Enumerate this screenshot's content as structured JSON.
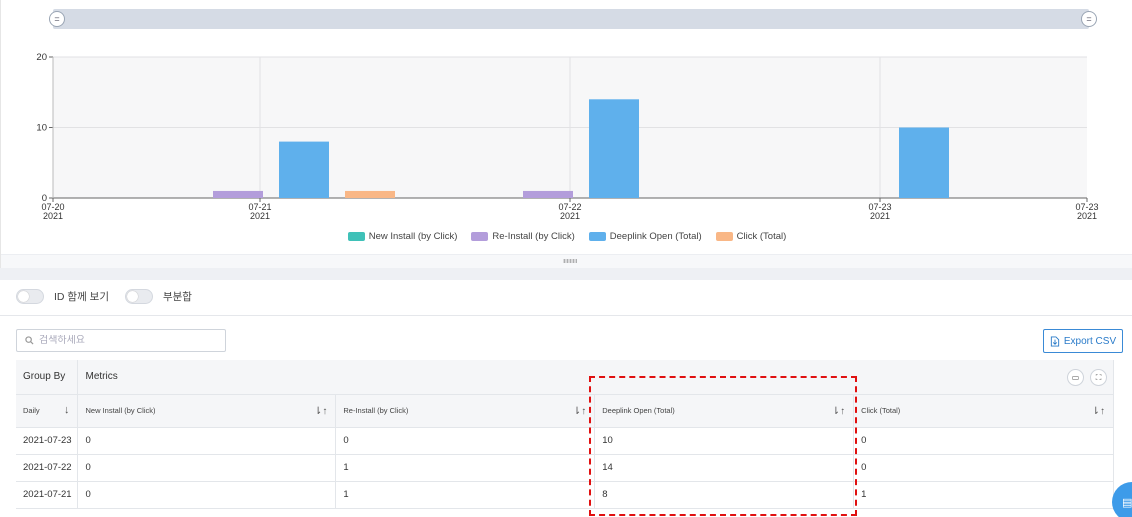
{
  "chart_data": {
    "type": "bar",
    "categories": [
      "07-20\n2021",
      "07-21\n2021",
      "07-22\n2021",
      "07-23\n2021",
      "07-23\n2021"
    ],
    "x_ticks": [
      {
        "line1": "07-20",
        "line2": "2021"
      },
      {
        "line1": "07-21",
        "line2": "2021"
      },
      {
        "line1": "07-22",
        "line2": "2021"
      },
      {
        "line1": "07-23",
        "line2": "2021"
      },
      {
        "line1": "07-23",
        "line2": "2021"
      }
    ],
    "y_ticks": [
      "0",
      "10",
      "20"
    ],
    "ylim": [
      0,
      20
    ],
    "days": [
      "07-21",
      "07-22",
      "07-23"
    ],
    "series": [
      {
        "name": "New Install (by Click)",
        "color": "#3fc1b8",
        "values": [
          0,
          0,
          0
        ]
      },
      {
        "name": "Re-Install (by Click)",
        "color": "#b39ddb",
        "values": [
          1,
          1,
          0
        ]
      },
      {
        "name": "Deeplink Open (Total)",
        "color": "#5fb0ec",
        "values": [
          8,
          14,
          10
        ]
      },
      {
        "name": "Click (Total)",
        "color": "#f9b786",
        "values": [
          1,
          0,
          0
        ]
      }
    ],
    "legend_position": "bottom",
    "grid": true
  },
  "slider": {
    "left_handle_icon": "grip-icon",
    "right_handle_icon": "grip-icon",
    "handle_glyph": "="
  },
  "toggles": [
    {
      "label": "ID 함께 보기",
      "on": false
    },
    {
      "label": "부분합",
      "on": false
    }
  ],
  "search": {
    "placeholder": "검색하세요",
    "icon": "search-icon"
  },
  "export": {
    "label": "Export CSV",
    "icon": "file-export-icon"
  },
  "table": {
    "group_by_header": "Group By",
    "metrics_header": "Metrics",
    "columns": [
      {
        "label": "Daily",
        "sort": "↓"
      },
      {
        "label": "New Install (by Click)",
        "sort": "⇂↑"
      },
      {
        "label": "Re-Install (by Click)",
        "sort": "⇂↑"
      },
      {
        "label": "Deeplink Open (Total)",
        "sort": "⇂↑"
      },
      {
        "label": "Click (Total)",
        "sort": "⇂↑"
      }
    ],
    "rows": [
      [
        "2021-07-23",
        "0",
        "0",
        "10",
        "0"
      ],
      [
        "2021-07-22",
        "0",
        "1",
        "14",
        "0"
      ],
      [
        "2021-07-21",
        "0",
        "1",
        "8",
        "1"
      ]
    ]
  },
  "colors": {
    "accent": "#2a7bc9",
    "highlight": "#e01010"
  }
}
